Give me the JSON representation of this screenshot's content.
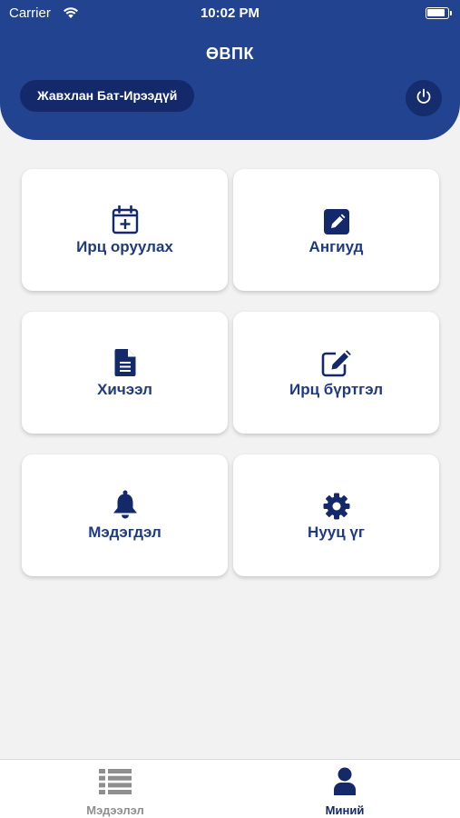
{
  "status_bar": {
    "carrier": "Carrier",
    "time": "10:02 PM"
  },
  "header": {
    "title": "ӨВПК",
    "user_name": "Жавхлан Бат-Ирээдүй"
  },
  "tiles": [
    {
      "label": "Ирц оруулах",
      "icon": "calendar-plus-icon"
    },
    {
      "label": "Ангиуд",
      "icon": "edit-square-icon"
    },
    {
      "label": "Хичээл",
      "icon": "document-icon"
    },
    {
      "label": "Ирц бүртгэл",
      "icon": "pen-square-icon"
    },
    {
      "label": "Мэдэгдэл",
      "icon": "bell-icon"
    },
    {
      "label": "Нууц үг",
      "icon": "gear-icon"
    }
  ],
  "tab_bar": {
    "items": [
      {
        "label": "Мэдээлэл",
        "icon": "list-icon",
        "active": false
      },
      {
        "label": "Миний",
        "icon": "user-icon",
        "active": true
      }
    ]
  },
  "colors": {
    "primary": "#214390",
    "dark": "#14296a",
    "background": "#f2f2f2",
    "inactive": "#8e8e8e"
  }
}
